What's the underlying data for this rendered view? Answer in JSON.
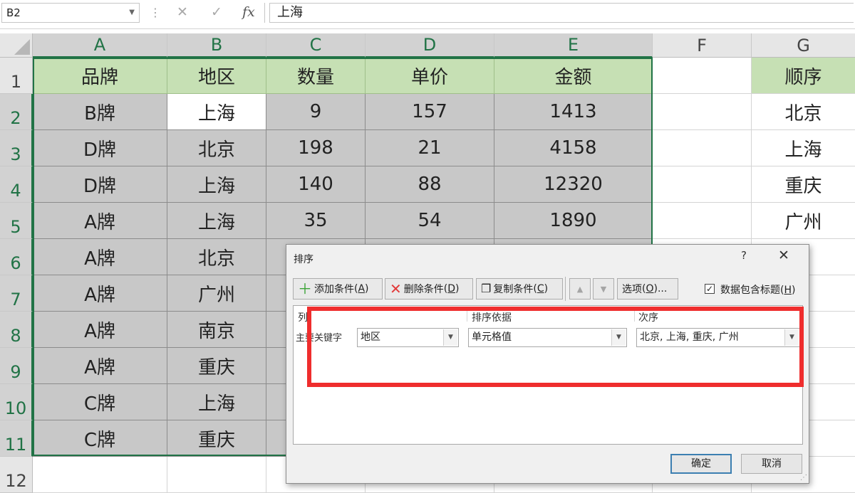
{
  "formula_bar": {
    "name_box": "B2",
    "cancel_symbol": "✕",
    "enter_symbol": "✓",
    "fx_symbol": "fx",
    "content": "上海"
  },
  "columns": [
    "A",
    "B",
    "C",
    "D",
    "E",
    "F",
    "G"
  ],
  "rows": [
    "1",
    "2",
    "3",
    "4",
    "5",
    "6",
    "7",
    "8",
    "9",
    "10",
    "11",
    "12"
  ],
  "header_row": [
    "品牌",
    "地区",
    "数量",
    "单价",
    "金额"
  ],
  "table": [
    [
      "B牌",
      "上海",
      "9",
      "157",
      "1413"
    ],
    [
      "D牌",
      "北京",
      "198",
      "21",
      "4158"
    ],
    [
      "D牌",
      "上海",
      "140",
      "88",
      "12320"
    ],
    [
      "A牌",
      "上海",
      "35",
      "54",
      "1890"
    ],
    [
      "A牌",
      "北京",
      "",
      "",
      ""
    ],
    [
      "A牌",
      "广州",
      "",
      "",
      ""
    ],
    [
      "A牌",
      "南京",
      "",
      "",
      ""
    ],
    [
      "A牌",
      "重庆",
      "",
      "",
      ""
    ],
    [
      "C牌",
      "上海",
      "",
      "",
      ""
    ],
    [
      "C牌",
      "重庆",
      "",
      "",
      ""
    ]
  ],
  "order_list": {
    "header": "顺序",
    "items": [
      "北京",
      "上海",
      "重庆",
      "广州"
    ]
  },
  "colors": {
    "header_fill": "#c6e0b4",
    "selection_fill": "#c8c8c8",
    "accent_green": "#217346",
    "highlight_red": "#ef2d2d"
  },
  "dialog": {
    "title": "排序",
    "help": "?",
    "close": "✕",
    "add_condition": "添加条件",
    "add_condition_key": "A",
    "delete_condition": "删除条件",
    "delete_condition_key": "D",
    "copy_condition": "复制条件",
    "copy_condition_key": "C",
    "options": "选项",
    "options_key": "O",
    "options_suffix": "...",
    "has_headers_label": "数据包含标题",
    "has_headers_key": "H",
    "has_headers_checked": true,
    "col_header": "列",
    "sort_on_header": "排序依据",
    "order_header": "次序",
    "primary_key_label": "主要关键字",
    "column_value": "地区",
    "sort_on_value": "单元格值",
    "order_value": "北京, 上海, 重庆, 广州",
    "ok": "确定",
    "cancel": "取消"
  }
}
